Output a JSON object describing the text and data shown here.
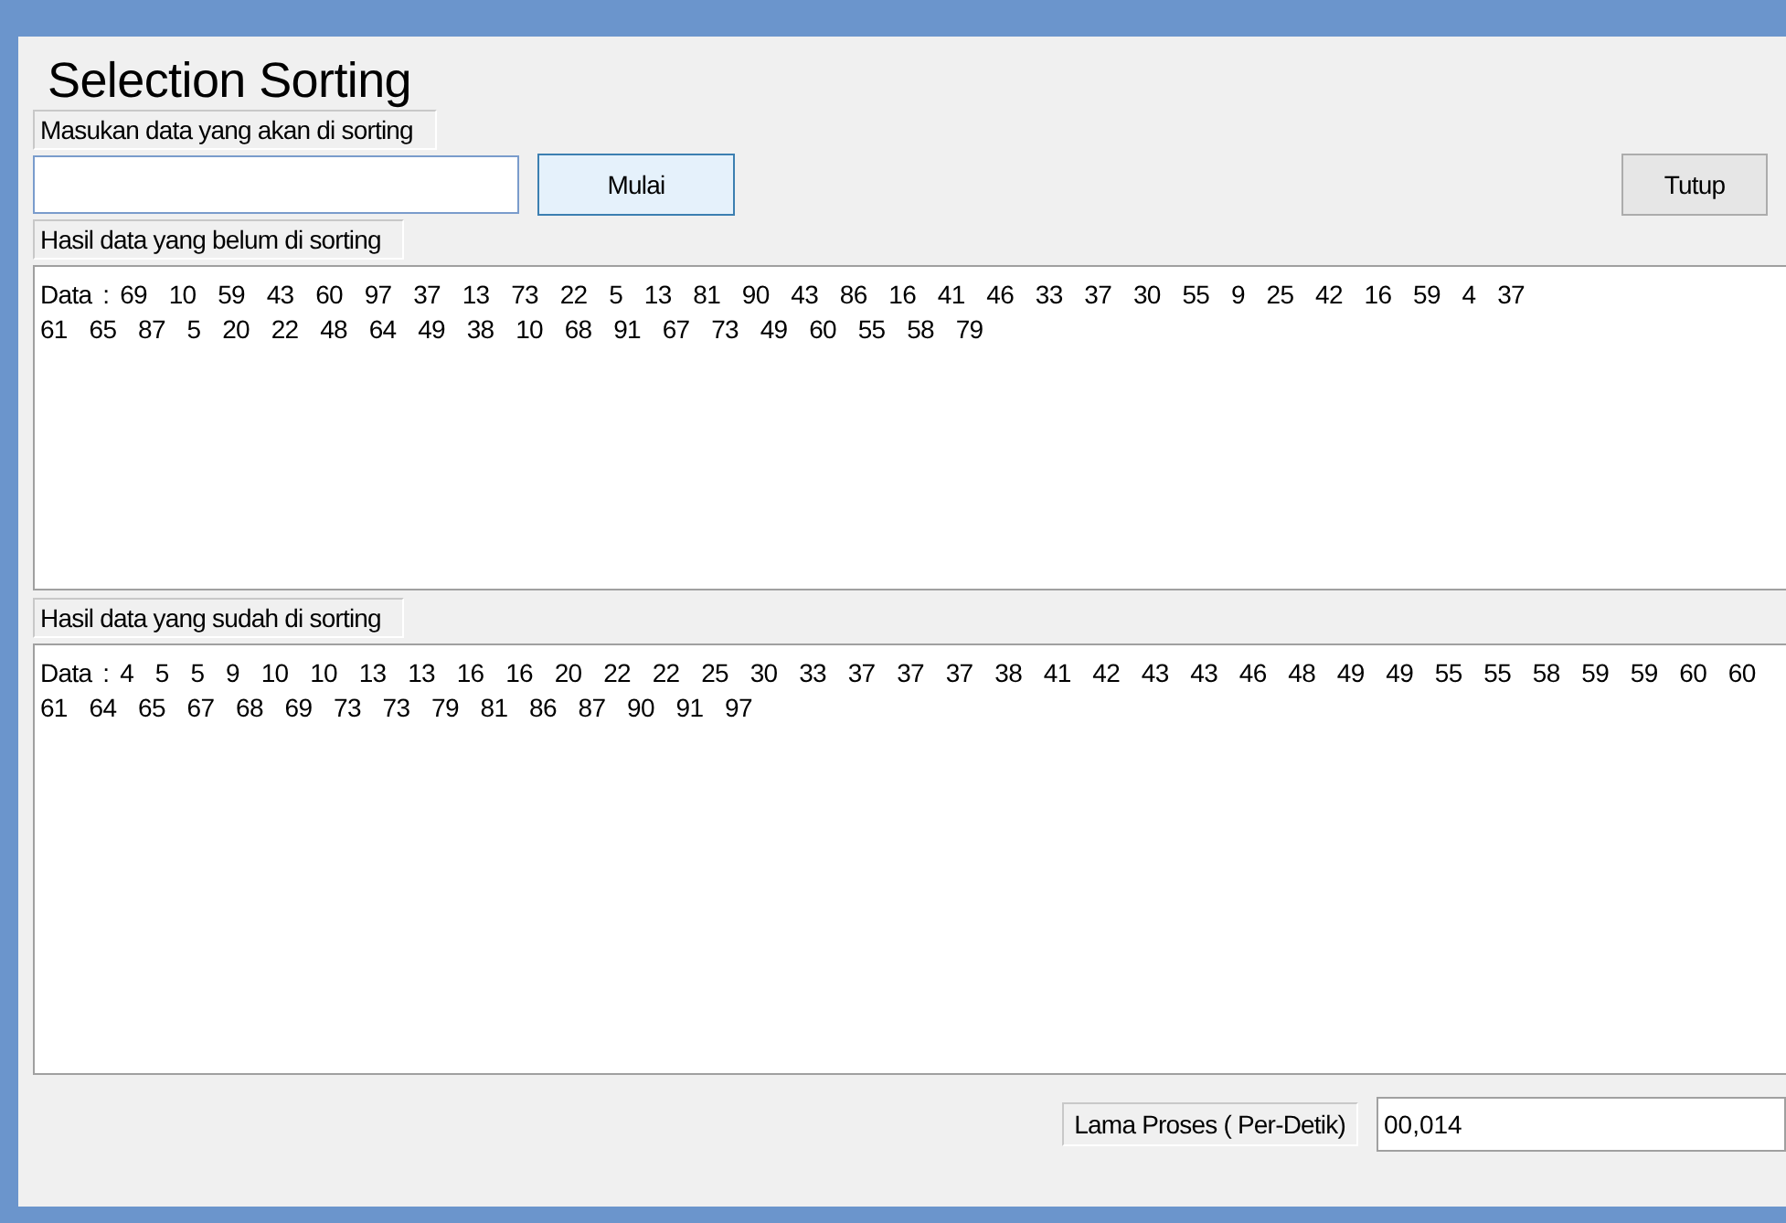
{
  "window": {
    "title": "Selection Sorting"
  },
  "input_section": {
    "label": "Masukan data yang akan di sorting",
    "field": {
      "kind": "text"
    },
    "buttons": [
      {
        "label": "Mulai",
        "focused": true
      },
      {
        "label": "Tutup",
        "focused": false
      }
    ]
  },
  "unsorted": {
    "label": "Hasil data yang belum di sorting",
    "lines": [
      "Data : 69  10  59  43  60  97  37  13  73  22  5  13  81  90  43  86  16  41  46  33  37  30  55  9  25  42  16  59  4  37",
      "61  65  87  5  20  22  48  64  49  38  10  68  91  67  73  49  60  55  58  79"
    ]
  },
  "sorted": {
    "label": "Hasil data yang sudah di sorting",
    "lines": [
      "Data : 4  5  5  9  10  10  13  13  16  16  20  22  22  25  30  33  37  37  37  38  41  42  43  43  46  48  49  49  55  55  58  59  59  60  60",
      "61  64  65  67  68  69  73  73  79  81  86  87  90  91  97"
    ]
  },
  "duration": {
    "label": "Lama Proses ( Per-Detik)",
    "value": "00,014"
  }
}
